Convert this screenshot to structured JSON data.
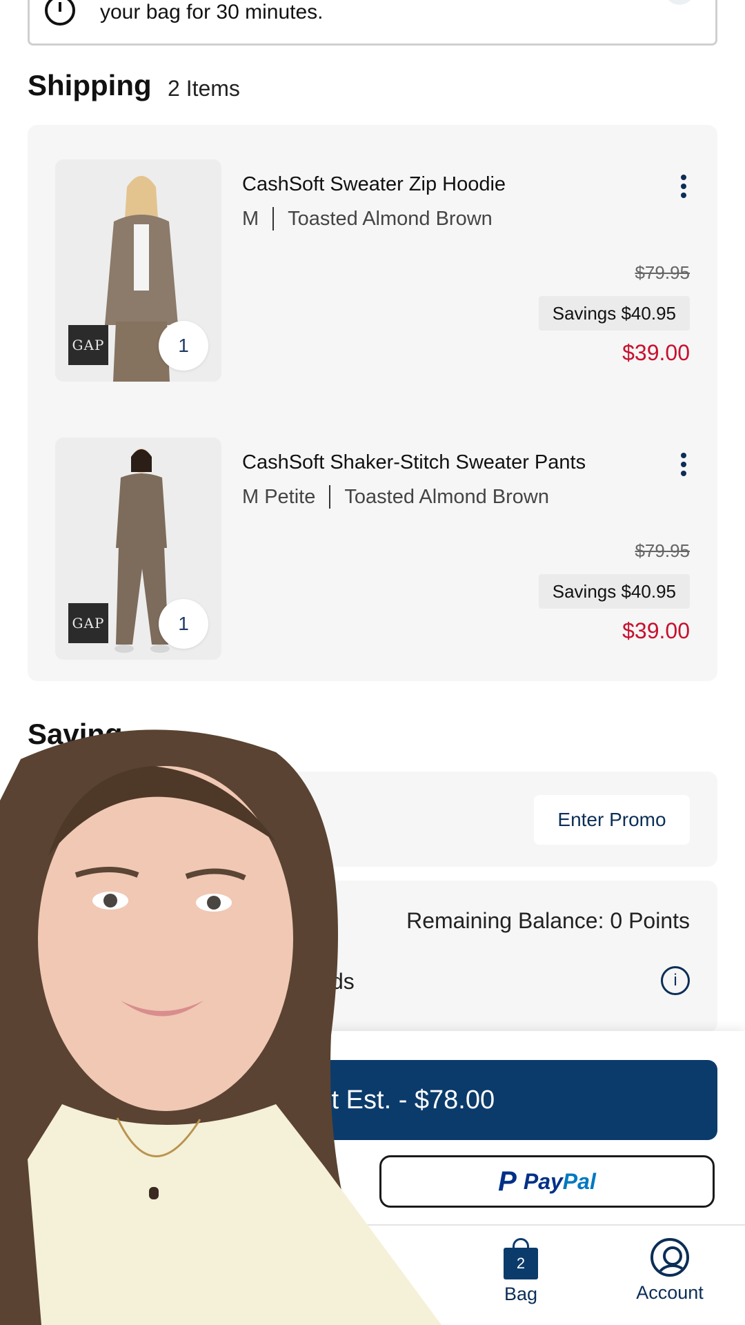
{
  "banner": {
    "message": "your bag for 30 minutes.",
    "close_symbol": "×"
  },
  "shipping": {
    "title": "Shipping",
    "count": "2 Items"
  },
  "items": [
    {
      "name": "CashSoft Sweater Zip Hoodie",
      "size": "M",
      "color": "Toasted Almond Brown",
      "original_price": "$79.95",
      "savings": "Savings $40.95",
      "price": "$39.00",
      "quantity": "1",
      "brand": "GAP"
    },
    {
      "name": "CashSoft Shaker-Stitch Sweater Pants",
      "size": "M  Petite",
      "color": "Toasted Almond Brown",
      "original_price": "$79.95",
      "savings": "Savings $40.95",
      "price": "$39.00",
      "quantity": "1",
      "brand": "GAP"
    }
  ],
  "savings_section": {
    "title": "Saving",
    "promo_button": "Enter Promo"
  },
  "rewards": {
    "balance": "Remaining Balance: 0 Points",
    "label_fragment": "ds",
    "info_symbol": "i"
  },
  "checkout": {
    "button_label": "ıt Est. - $78.00",
    "paypal_p": "P",
    "paypal_pay": "Pay",
    "paypal_pal": "Pal"
  },
  "tabbar": {
    "bag_label": "Bag",
    "bag_count": "2",
    "account_label": "Account"
  },
  "colors": {
    "navy": "#0b3b6b",
    "sale_red": "#c8102e",
    "card_bg": "#f6f6f6"
  }
}
